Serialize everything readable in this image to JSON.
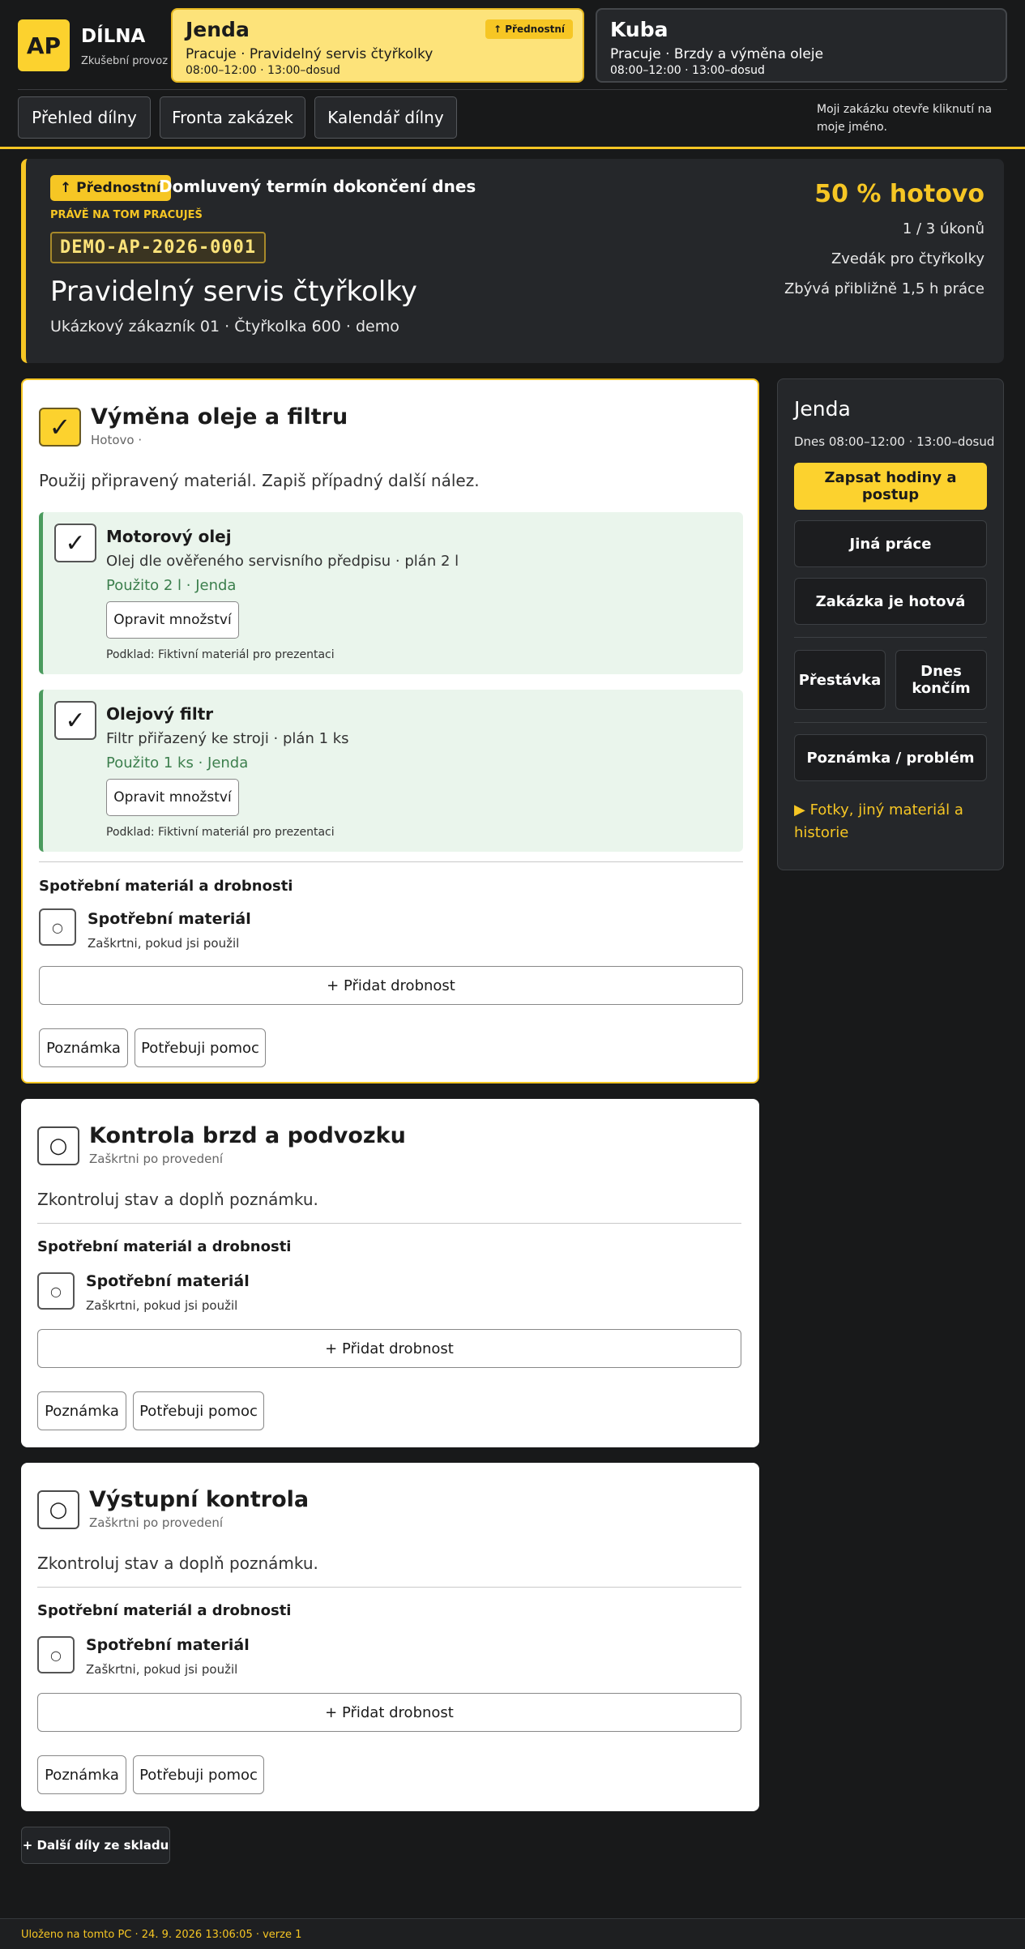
{
  "brand": {
    "logo": "AP",
    "title": "DÍLNA",
    "subtitle": "Zkušební provoz"
  },
  "workers": [
    {
      "name": "Jenda",
      "badge": "↑ Přednostní",
      "status": "Pracuje · Pravidelný servis čtyřkolky",
      "hours": "08:00–12:00 · 13:00–dosud"
    },
    {
      "name": "Kuba",
      "status": "Pracuje · Brzdy a výměna oleje",
      "hours": "08:00–12:00 · 13:00–dosud"
    }
  ],
  "nav": {
    "overview": "Přehled dílny",
    "queue": "Fronta zakázek",
    "calendar": "Kalendář dílny",
    "hint": "Moji zakázku otevře kliknutí na moje jméno."
  },
  "job": {
    "priority": "↑ Přednostní",
    "deadline": "Domluvený termín dokončení dnes",
    "working_label": "PRÁVĚ NA TOM PRACUJEŠ",
    "code": "DEMO-AP-2026-0001",
    "title": "Pravidelný servis čtyřkolky",
    "meta": "Ukázkový zákazník 01 · Čtyřkolka 600 · demo",
    "progress": "50 % hotovo",
    "progress_value": 0.5,
    "tasks_done": "1 / 3 úkonů",
    "lift": "Zvedák pro čtyřkolky",
    "remaining": "Zbývá přibližně 1,5 h práce"
  },
  "tasks": [
    {
      "title": "Výměna oleje a filtru",
      "status": "Hotovo ·",
      "check": "✓",
      "instruction": "Použij připravený materiál. Zapiš případný další nález.",
      "materials": [
        {
          "name": "Motorový olej",
          "desc": "Olej dle ověřeného servisního předpisu · plán 2 l",
          "used": "Použito 2 l · Jenda",
          "fix": "Opravit množství",
          "source": "Podklad: Fiktivní materiál pro prezentaci",
          "check": "✓"
        },
        {
          "name": "Olejový filtr",
          "desc": "Filtr přiřazený ke stroji · plán 1 ks",
          "used": "Použito 1 ks · Jenda",
          "fix": "Opravit množství",
          "source": "Podklad: Fiktivní materiál pro prezentaci",
          "check": "✓"
        }
      ],
      "section_title": "Spotřební materiál a drobnosti",
      "consumable": {
        "name": "Spotřební materiál",
        "hint": "Zaškrtni, pokud jsi použil",
        "check": "○"
      },
      "add_label": "+  Přidat drobnost",
      "note_label": "Poznámka",
      "help_label": "Potřebuji pomoc"
    },
    {
      "title": "Kontrola brzd a podvozku",
      "status": "Zaškrtni po provedení",
      "check": "○",
      "instruction": "Zkontroluj stav a doplň poznámku.",
      "section_title": "Spotřební materiál a drobnosti",
      "consumable": {
        "name": "Spotřební materiál",
        "hint": "Zaškrtni, pokud jsi použil",
        "check": "○"
      },
      "add_label": "+  Přidat drobnost",
      "note_label": "Poznámka",
      "help_label": "Potřebuji pomoc"
    },
    {
      "title": "Výstupní kontrola",
      "status": "Zaškrtni po provedení",
      "check": "○",
      "instruction": "Zkontroluj stav a doplň poznámku.",
      "section_title": "Spotřební materiál a drobnosti",
      "consumable": {
        "name": "Spotřební materiál",
        "hint": "Zaškrtni, pokud jsi použil",
        "check": "○"
      },
      "add_label": "+  Přidat drobnost",
      "note_label": "Poznámka",
      "help_label": "Potřebuji pomoc"
    }
  ],
  "side": {
    "name": "Jenda",
    "hours": "Dnes 08:00–12:00 · 13:00–dosud",
    "log_hours": "Zapsat hodiny a postup",
    "other_work": "Jiná práce",
    "job_done": "Zakázka je hotová",
    "break": "Přestávka",
    "end_day": "Dnes končím",
    "note_problem": "Poznámka / problém",
    "details": "▶  Fotky, jiný materiál a historie"
  },
  "extra_parts": "+  Další díly ze skladu",
  "footer": "Uloženo na tomto PC · 24. 9. 2026 13:06:05 · verze 1",
  "colors": {
    "accent": "#fcd22e",
    "background": "#18191a",
    "panel": "#25272a",
    "done_green": "#4b9b5e"
  }
}
